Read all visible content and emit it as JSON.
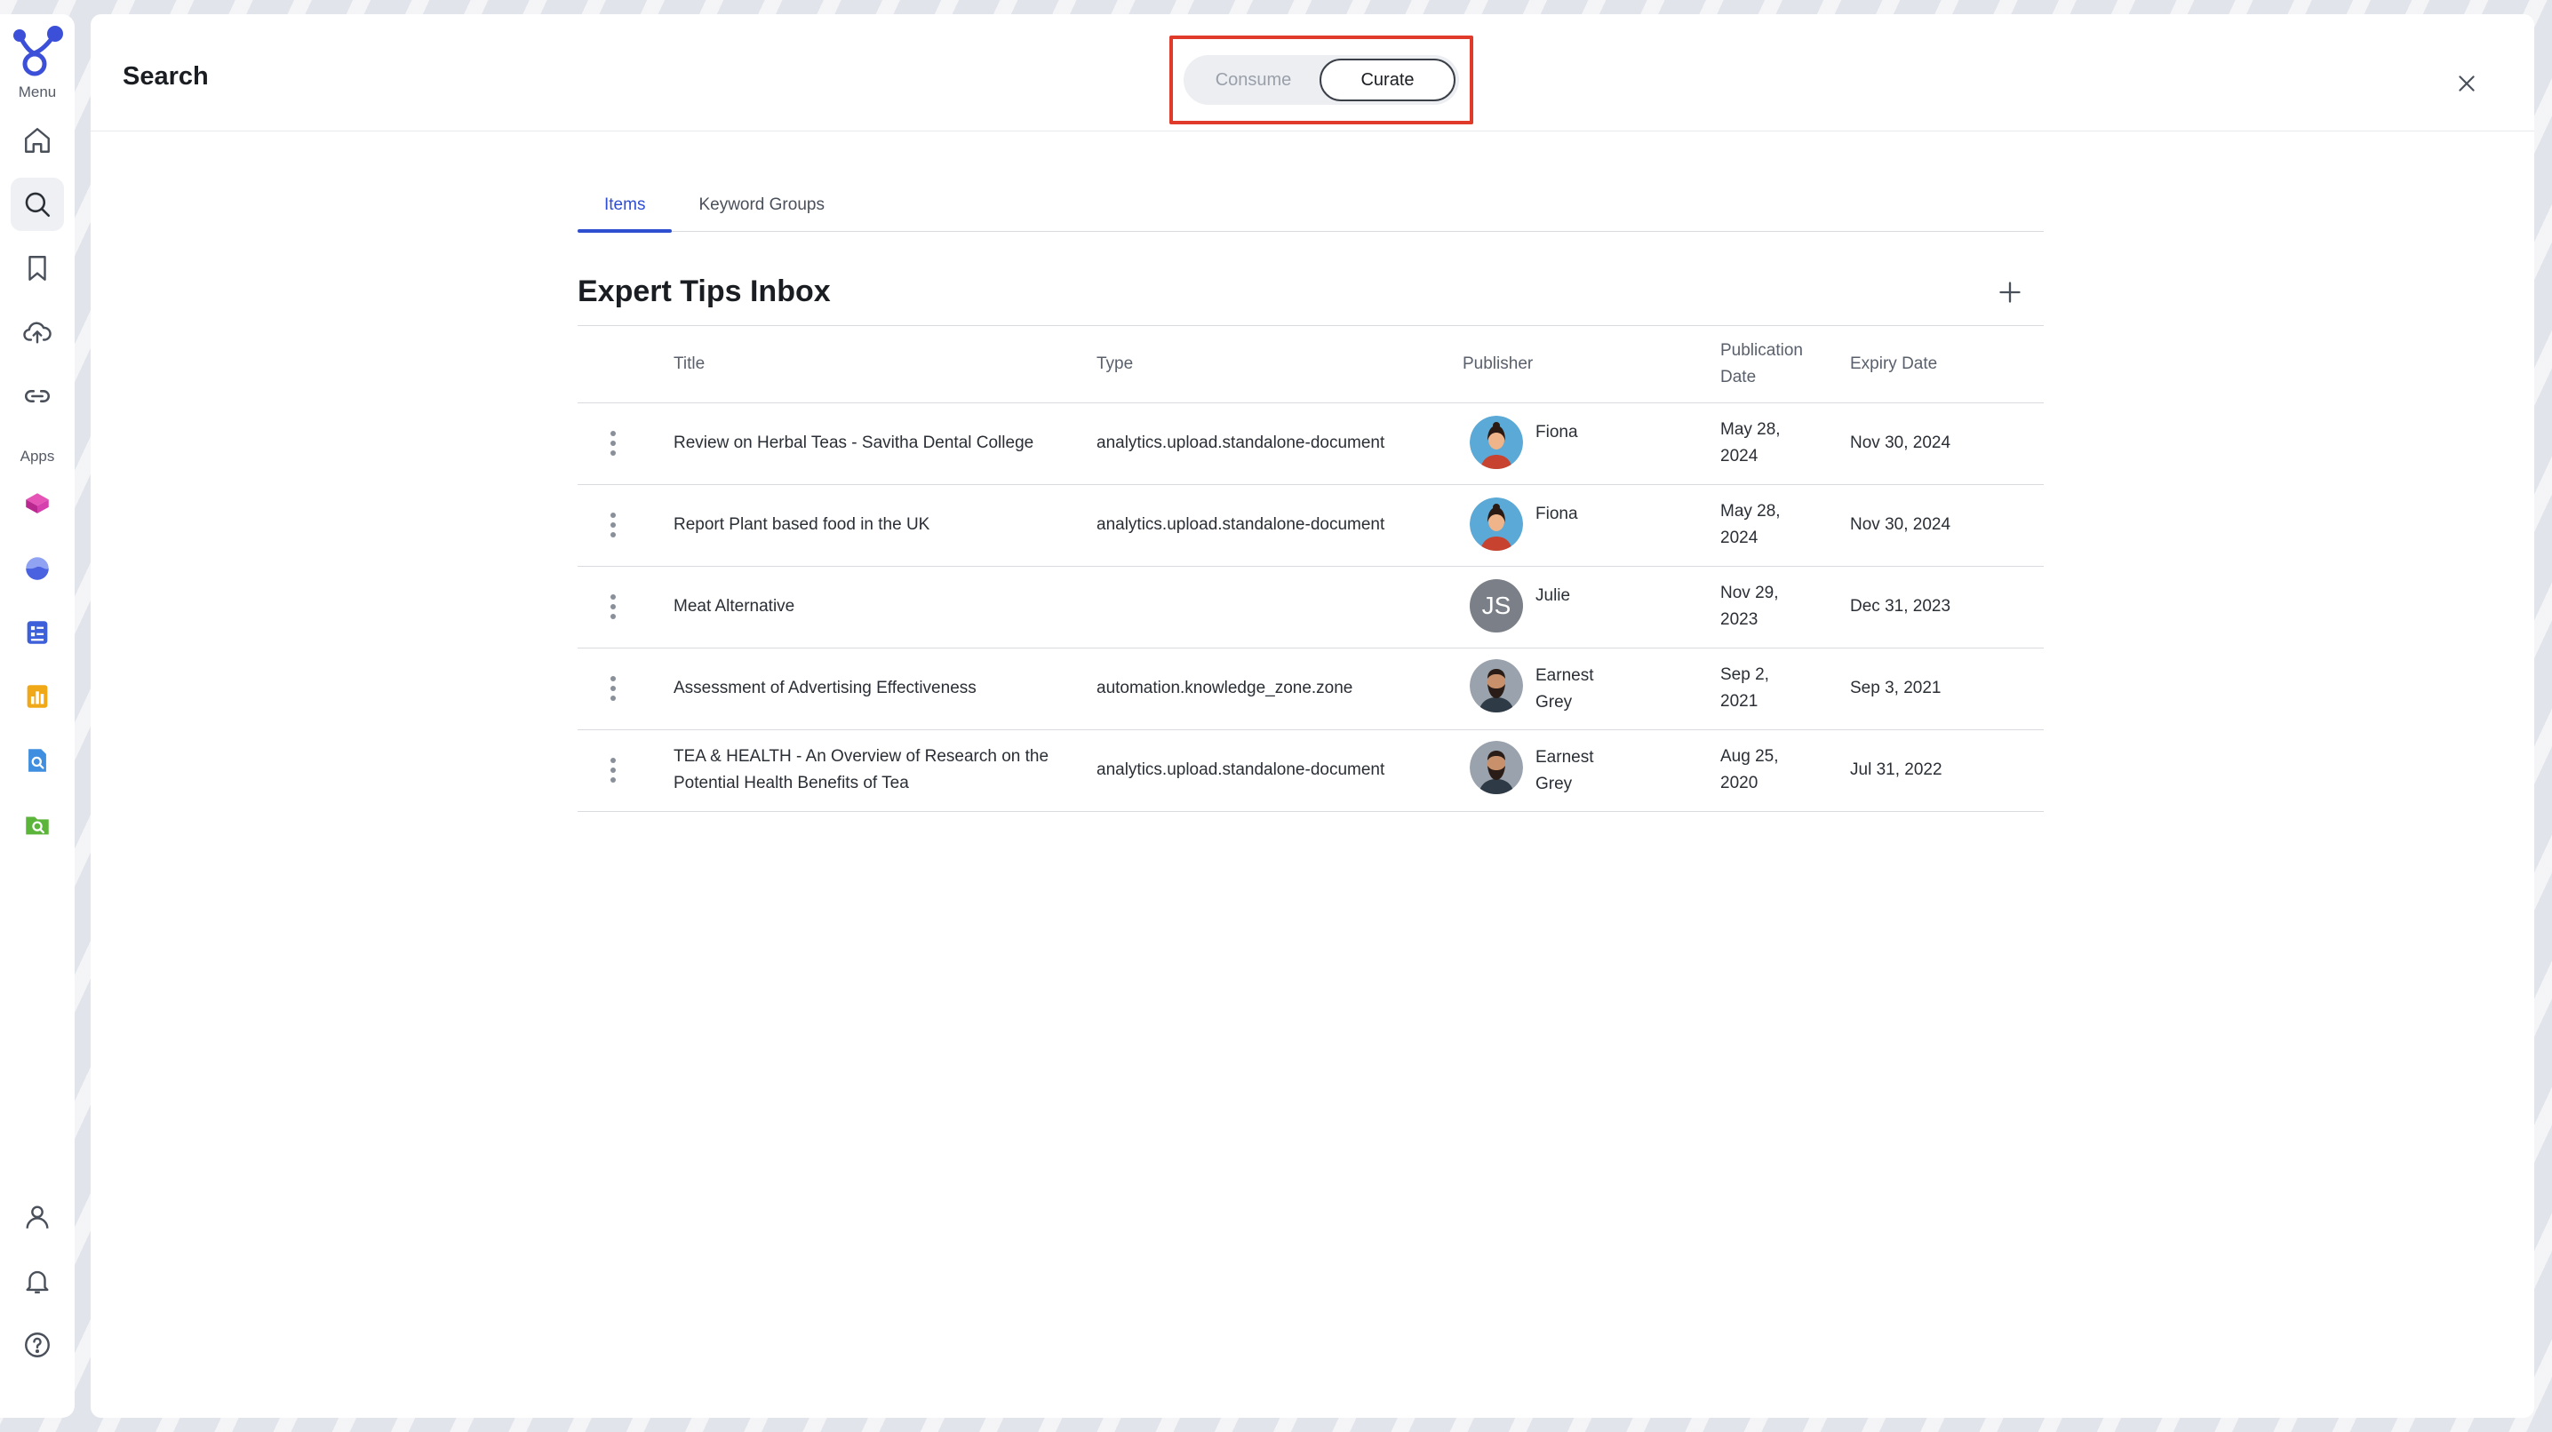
{
  "rail": {
    "menu_label": "Menu",
    "apps_label": "Apps",
    "menu_items": [
      {
        "name": "home-icon"
      },
      {
        "name": "search-icon"
      },
      {
        "name": "bookmark-icon"
      },
      {
        "name": "upload-icon"
      },
      {
        "name": "link-icon"
      }
    ],
    "apps": [
      {
        "name": "app-cube-icon",
        "color": "#d63fae"
      },
      {
        "name": "app-wave-icon",
        "color": "#4a62e0"
      },
      {
        "name": "app-document-icon",
        "color": "#3d5fd9"
      },
      {
        "name": "app-chart-icon",
        "color": "#f0a817"
      },
      {
        "name": "app-file-search-icon",
        "color": "#3f8ee0"
      },
      {
        "name": "app-folder-search-icon",
        "color": "#5bb53a"
      }
    ],
    "bottom_items": [
      {
        "name": "user-icon"
      },
      {
        "name": "bell-icon"
      },
      {
        "name": "help-icon"
      }
    ]
  },
  "header": {
    "title": "Search",
    "mode_options": [
      "Consume",
      "Curate"
    ],
    "selected_mode": "Curate",
    "highlight_color": "#e03a2a"
  },
  "tabs": [
    "Items",
    "Keyword Groups"
  ],
  "active_tab": "Items",
  "section": {
    "title": "Expert Tips Inbox"
  },
  "table": {
    "columns": [
      "Title",
      "Type",
      "Publisher",
      "Publication Date",
      "Expiry Date"
    ],
    "rows": [
      {
        "title": "Review on Herbal Teas - Savitha Dental College",
        "type": "analytics.upload.standalone-document",
        "publisher": "Fiona",
        "avatar": "fiona",
        "publication_date": "May 28, 2024",
        "expiry_date": "Nov 30, 2024"
      },
      {
        "title": "Report Plant based food in the UK",
        "type": "analytics.upload.standalone-document",
        "publisher": "Fiona",
        "avatar": "fiona",
        "publication_date": "May 28, 2024",
        "expiry_date": "Nov 30, 2024"
      },
      {
        "title": "Meat Alternative",
        "type": "",
        "publisher": "Julie",
        "avatar": "initials",
        "initials": "JS",
        "publication_date": "Nov 29, 2023",
        "expiry_date": "Dec 31, 2023"
      },
      {
        "title": "Assessment of Advertising Effectiveness",
        "type": "automation.knowledge_zone.zone",
        "publisher": "Earnest Grey",
        "avatar": "earnest",
        "publication_date": "Sep 2, 2021",
        "expiry_date": "Sep 3, 2021"
      },
      {
        "title": "TEA & HEALTH - An Overview of Research on the Potential Health Benefits of Tea",
        "type": "analytics.upload.standalone-document",
        "publisher": "Earnest Grey",
        "avatar": "earnest",
        "publication_date": "Aug 25, 2020",
        "expiry_date": "Jul 31, 2022"
      }
    ]
  },
  "colors": {
    "accent": "#2f4fd1",
    "brand": "#3b4fd8"
  }
}
